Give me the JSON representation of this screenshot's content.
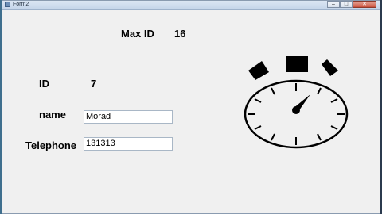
{
  "window": {
    "title": "Form2",
    "minimize_symbol": "–",
    "maximize_symbol": "□",
    "close_symbol": "✕"
  },
  "form": {
    "max_id_label": "Max ID",
    "max_id_value": "16",
    "id_label": "ID",
    "id_value": "7",
    "name_label": "name",
    "name_value": "Morad",
    "telephone_label": "Telephone",
    "telephone_value": "131313"
  },
  "icons": {
    "stopwatch": "stopwatch-icon"
  },
  "colors": {
    "form_background": "#f0f0f0",
    "clock_stroke": "#000000"
  }
}
